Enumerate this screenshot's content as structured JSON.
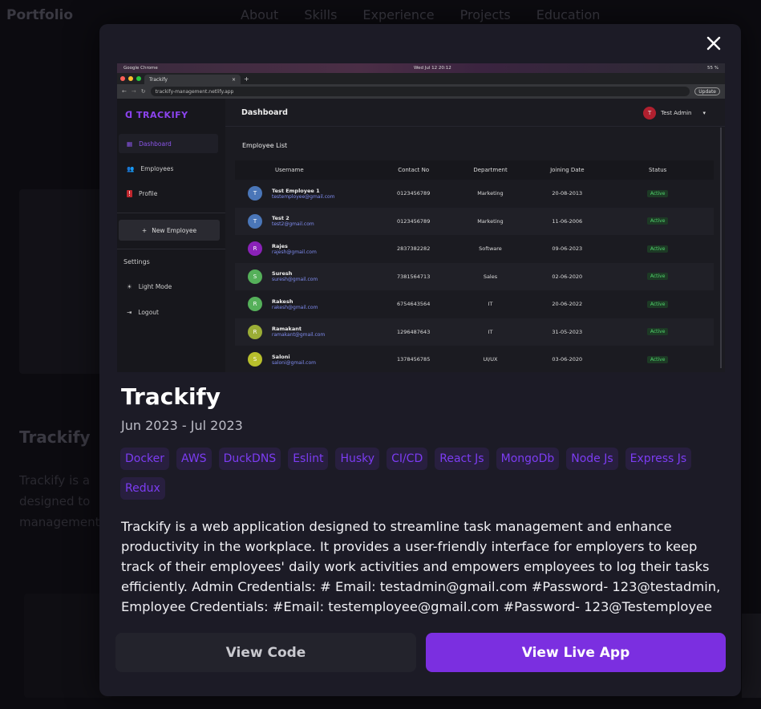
{
  "background": {
    "logo": "Portfolio",
    "nav": [
      "About",
      "Skills",
      "Experience",
      "Projects",
      "Education"
    ],
    "card_title": "Trackify",
    "card_text_lines": [
      "Trackify is a",
      "designed to",
      "management"
    ]
  },
  "modal": {
    "close_symbol": "✕",
    "title": "Trackify",
    "date": "Jun 2023 - Jul 2023",
    "tags": [
      "Docker",
      "AWS",
      "DuckDNS",
      "Eslint",
      "Husky",
      "CI/CD",
      "React Js",
      "MongoDb",
      "Node Js",
      "Express Js",
      "Redux"
    ],
    "description": "Trackify is a web application designed to streamline task management and enhance productivity in the workplace. It provides a user-friendly interface for employers to keep track of their employees' daily work activities and empowers employees to log their tasks efficiently. Admin Credentials: # Email: testadmin@gmail.com #Password- 123@testadmin, Employee Credentials: #Email: testemployee@gmail.com #Password- 123@Testemployee",
    "view_code_label": "View Code",
    "view_live_label": "View Live App",
    "accent_color": "#7b2fe0"
  },
  "preview": {
    "os_app": "Google Chrome",
    "os_clock": "Wed Jul 12  20:12",
    "os_battery": "55 %",
    "tab_title": "Trackify",
    "url": "trackify-management.netlify.app",
    "update_label": "Update",
    "app_logo": "TRACKIFY",
    "sidebar": {
      "dashboard": "Dashboard",
      "employees": "Employees",
      "profile": "Profile",
      "new_employee": "New Employee",
      "settings": "Settings",
      "light_mode": "Light Mode",
      "logout": "Logout"
    },
    "header_title": "Dashboard",
    "admin_initial": "T",
    "admin_name": "Test Admin",
    "list_title": "Employee List",
    "columns": [
      "Username",
      "Contact No",
      "Department",
      "Joining Date",
      "Status"
    ],
    "rows": [
      {
        "initial": "T",
        "color": "#4a76b8",
        "name": "Test Employee 1",
        "email": "testemployee@gmail.com",
        "phone": "0123456789",
        "dept": "Marketing",
        "date": "20-08-2013",
        "status": "Active"
      },
      {
        "initial": "T",
        "color": "#4a76b8",
        "name": "Test 2",
        "email": "test2@gmail.com",
        "phone": "0123456789",
        "dept": "Marketing",
        "date": "11-06-2006",
        "status": "Active"
      },
      {
        "initial": "R",
        "color": "#8a22b8",
        "name": "Rajes",
        "email": "rajesh@gmail.com",
        "phone": "2837382282",
        "dept": "Software",
        "date": "09-06-2023",
        "status": "Active"
      },
      {
        "initial": "S",
        "color": "#55b05a",
        "name": "Suresh",
        "email": "suresh@gmail.com",
        "phone": "7381564713",
        "dept": "Sales",
        "date": "02-06-2020",
        "status": "Active"
      },
      {
        "initial": "R",
        "color": "#55b05a",
        "name": "Rakesh",
        "email": "rakesh@gmail.com",
        "phone": "6754643564",
        "dept": "IT",
        "date": "20-06-2022",
        "status": "Active"
      },
      {
        "initial": "R",
        "color": "#9bad36",
        "name": "Ramakant",
        "email": "ramakant@gmail.com",
        "phone": "1296487643",
        "dept": "IT",
        "date": "31-05-2023",
        "status": "Active"
      },
      {
        "initial": "S",
        "color": "#b8bf2c",
        "name": "Saloni",
        "email": "saloni@gmail.com",
        "phone": "1378456785",
        "dept": "UI/UX",
        "date": "03-06-2020",
        "status": "Active"
      }
    ]
  }
}
